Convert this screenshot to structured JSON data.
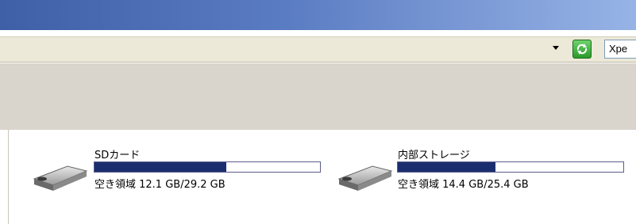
{
  "address": {
    "value": "Xpe",
    "go_icon": "refresh-arrows-icon",
    "dropdown_icon": "chevron-down-icon"
  },
  "drives": [
    {
      "name": "SDカード",
      "free_label": "空き領域 12.1 GB/29.2 GB",
      "used_fraction": 0.586,
      "icon": "removable-drive-icon"
    },
    {
      "name": "内部ストレージ",
      "free_label": "空き領域 14.4 GB/25.4 GB",
      "used_fraction": 0.433,
      "icon": "removable-drive-icon"
    }
  ],
  "colors": {
    "capacity_fill": "#1a2e6f",
    "address_bar": "#ece9d8",
    "toolbar": "#d9d5cc"
  }
}
